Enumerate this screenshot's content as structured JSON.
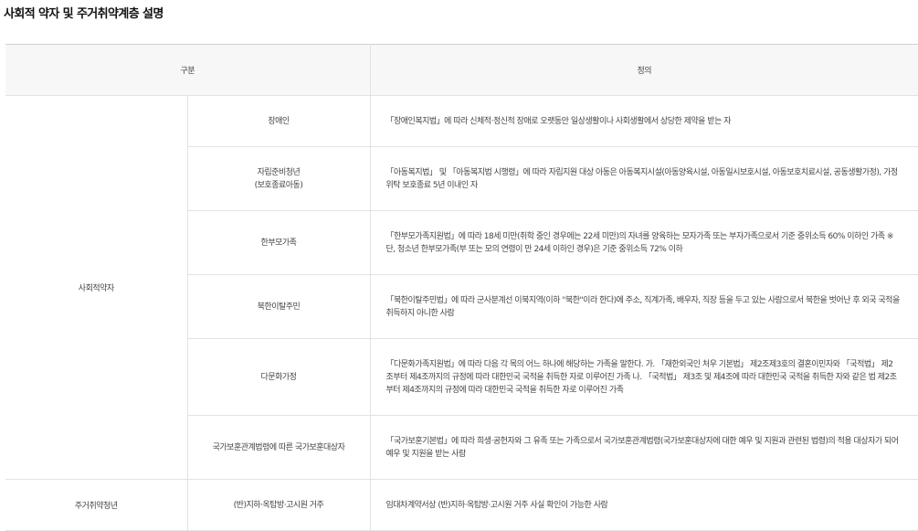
{
  "page": {
    "title": "사회적 약자 및 주거취약계층 설명"
  },
  "table": {
    "headers": [
      "구분",
      "정의"
    ],
    "group1": {
      "category": "사회적약자",
      "rows": [
        {
          "sub": "장애인",
          "definition": "「장애인복지법」에 따라 신체적·정신적 장애로 오랫동안 일상생활이나 사회생활에서 상당한 제약을 받는 자"
        },
        {
          "sub_line1": "자립준비청년",
          "sub_line2": "(보호종료아동)",
          "definition": "「아동복지법」 및 「아동복지법 시행령」에 따라 자립지원 대상 아동은 아동복지시설(아동양육시설, 아동일시보호시설, 아동보호치료시설, 공동생활가정), 가정위탁 보호종료 5년 이내인 자"
        },
        {
          "sub": "한부모가족",
          "definition": "「한부모가족지원법」에 따라 18세 미만(취학 중인 경우에는 22세 미만)의 자녀를 양육하는 모자가족 또는 부자가족으로서 기준 중위소득 60% 이하인 가족 ※단, 청소년 한부모가족(부 또는 모의 연령이 만 24세 이하인 경우)은 기준 중위소득 72% 이하"
        },
        {
          "sub": "북한이탈주민",
          "definition": "「북한이탈주민법」에 따라 군사분계선 이북지역(이하 \"북한\"이라 한다)에 주소, 직계가족, 배우자, 직장 등을 두고 있는 사람으로서 북한을 벗어난 후 외국 국적을 취득하지 아니한 사람"
        },
        {
          "sub": "다문화가정",
          "definition": "「다문화가족지원법」에 따라 다음 각 목의 어느 하나에 해당하는 가족을 말한다. 가. 「재한외국인 처우 기본법」 제2조제3호의 결혼이민자와 「국적법」 제2조부터 제4조까지의 규정에 따라 대한민국 국적을 취득한 자로 이루어진 가족 나. 「국적법」 제3조 및 제4조에 따라 대한민국 국적을 취득한 자와 같은 법 제2조부터 제4조까지의 규정에 따라 대한민국 국적을 취득한 자로 이루어진 가족"
        },
        {
          "sub": "국가보훈관계법령에 따른 국가보훈대상자",
          "definition": "「국가보훈기본법」에 따라 희생·공헌자와 그 유족 또는 가족으로서 국가보훈관계법령(국가보훈대상자에 대한 예우 및 지원과 관련된 법령)의 적용 대상자가 되어 예우 및 지원을 받는 사람"
        }
      ]
    },
    "group2": {
      "category": "주거취약청년",
      "rows": [
        {
          "sub": "(반)지하·옥탑방·고시원 거주",
          "definition": "임대차계약서상 (반)지하·옥탑방·고시원 거주 사실 확인이 가능한 사람"
        }
      ]
    }
  }
}
